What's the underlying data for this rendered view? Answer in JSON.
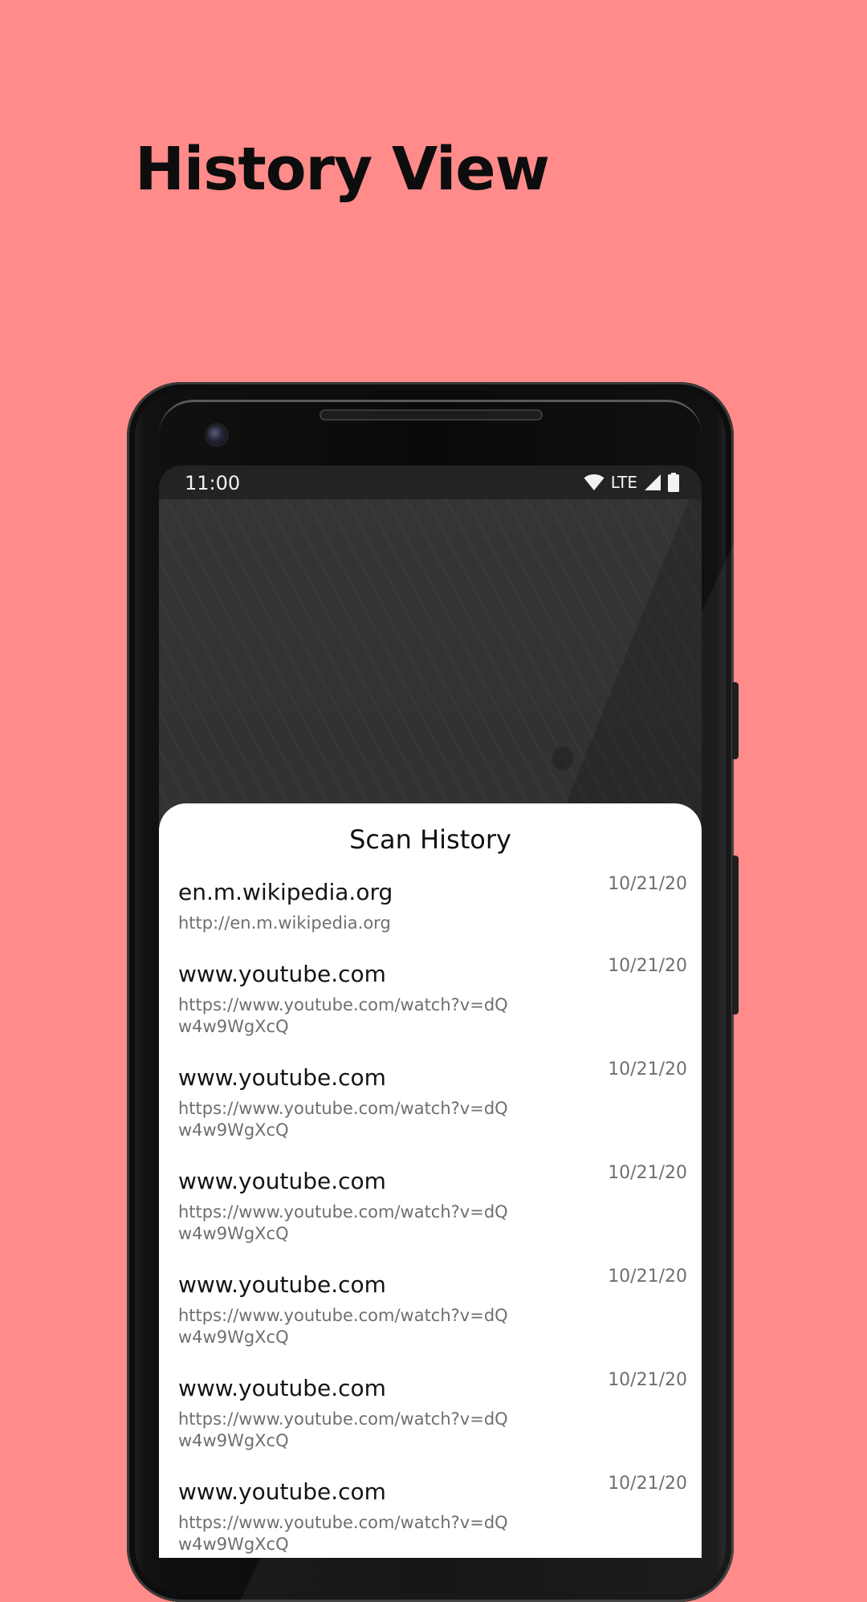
{
  "headline": "History View",
  "status_bar": {
    "time": "11:00",
    "network": "LTE"
  },
  "sheet": {
    "title": "Scan History",
    "items": [
      {
        "host": "en.m.wikipedia.org",
        "url": "http://en.m.wikipedia.org",
        "date": "10/21/20"
      },
      {
        "host": "www.youtube.com",
        "url": "https://www.youtube.com/watch?v=dQw4w9WgXcQ",
        "date": "10/21/20"
      },
      {
        "host": "www.youtube.com",
        "url": "https://www.youtube.com/watch?v=dQw4w9WgXcQ",
        "date": "10/21/20"
      },
      {
        "host": "www.youtube.com",
        "url": "https://www.youtube.com/watch?v=dQw4w9WgXcQ",
        "date": "10/21/20"
      },
      {
        "host": "www.youtube.com",
        "url": "https://www.youtube.com/watch?v=dQw4w9WgXcQ",
        "date": "10/21/20"
      },
      {
        "host": "www.youtube.com",
        "url": "https://www.youtube.com/watch?v=dQw4w9WgXcQ",
        "date": "10/21/20"
      },
      {
        "host": "www.youtube.com",
        "url": "https://www.youtube.com/watch?v=dQw4w9WgXcQ",
        "date": "10/21/20"
      }
    ]
  },
  "icons": {
    "wifi": "wifi-icon",
    "signal": "cell-signal-icon",
    "battery": "battery-icon",
    "camera": "front-camera-icon",
    "speaker": "earpiece-speaker-icon"
  },
  "colors": {
    "background": "#ff8b8a",
    "headline": "#0d0d0d",
    "sheet": "#ffffff",
    "primary_text": "#141414",
    "secondary_text": "#6f6f6f"
  }
}
